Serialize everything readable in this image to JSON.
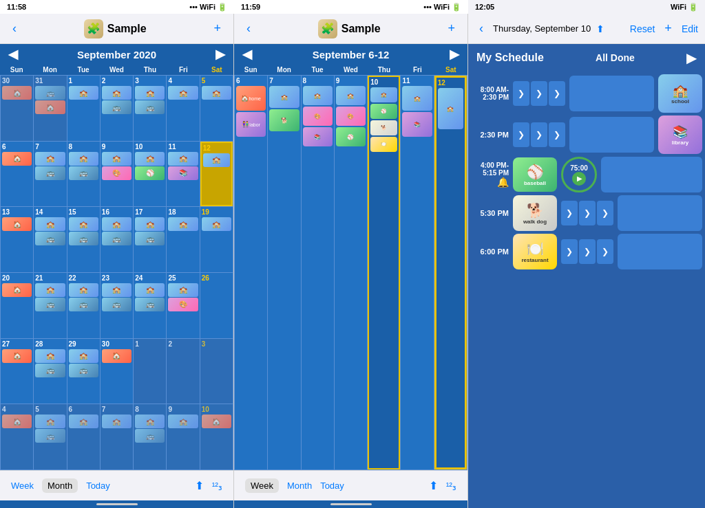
{
  "panels": {
    "panel1": {
      "status_time": "11:58",
      "nav_title": "Sample",
      "cal_title": "September 2020",
      "view_mode": "Month",
      "toolbar": {
        "week_label": "Week",
        "month_label": "Month",
        "today_label": "Today"
      }
    },
    "panel2": {
      "status_time": "11:59",
      "nav_title": "Sample",
      "cal_title": "September 6-12",
      "toolbar": {
        "week_label": "Week",
        "month_label": "Month",
        "today_label": "Today"
      }
    },
    "panel3": {
      "status_time": "12:05",
      "nav_title": "Thursday, September 10",
      "reset_label": "Reset",
      "edit_label": "Edit",
      "schedule_title": "My Schedule",
      "all_done_label": "All Done",
      "times": [
        {
          "time": "8:00 AM-\n2:30 PM",
          "event": "school",
          "type": "school",
          "done": true
        },
        {
          "time": "2:30 PM",
          "event": "library",
          "type": "library",
          "done": true
        },
        {
          "time": "4:00 PM-\n5:15 PM",
          "event": "baseball",
          "type": "baseball",
          "timer": "75:00",
          "active": true
        },
        {
          "time": "5:30 PM",
          "event": "walk dog",
          "type": "dog",
          "done": false
        },
        {
          "time": "6:00 PM",
          "event": "restaurant",
          "type": "restaurant",
          "done": false
        }
      ]
    }
  },
  "days": [
    "Sun",
    "Mon",
    "Tue",
    "Wed",
    "Thu",
    "Fri",
    "Sat"
  ],
  "month_weeks": [
    [
      {
        "num": "30",
        "other": true,
        "events": [
          "home"
        ]
      },
      {
        "num": "31",
        "other": true,
        "events": [
          "bus",
          "home"
        ]
      },
      {
        "num": "1",
        "events": [
          "school"
        ]
      },
      {
        "num": "2",
        "events": [
          "school",
          "bus"
        ]
      },
      {
        "num": "3",
        "events": [
          "school",
          "bus"
        ]
      },
      {
        "num": "4",
        "events": [
          "school"
        ]
      },
      {
        "num": "5",
        "events": [
          "school"
        ]
      }
    ],
    [
      {
        "num": "6",
        "events": [
          "home"
        ]
      },
      {
        "num": "7",
        "events": [
          "school",
          "bus"
        ]
      },
      {
        "num": "8",
        "events": [
          "school",
          "bus"
        ]
      },
      {
        "num": "9",
        "events": [
          "school",
          "art"
        ]
      },
      {
        "num": "10",
        "events": [
          "school",
          "baseball"
        ]
      },
      {
        "num": "11",
        "events": [
          "school",
          "library"
        ]
      },
      {
        "num": "12",
        "events": [
          "school"
        ],
        "highlight": true
      }
    ],
    [
      {
        "num": "13",
        "events": [
          "home"
        ]
      },
      {
        "num": "14",
        "events": [
          "school",
          "bus"
        ]
      },
      {
        "num": "15",
        "events": [
          "school",
          "bus"
        ]
      },
      {
        "num": "16",
        "events": [
          "school",
          "bus"
        ]
      },
      {
        "num": "17",
        "events": [
          "school",
          "bus"
        ]
      },
      {
        "num": "18",
        "events": [
          "school"
        ]
      },
      {
        "num": "19",
        "events": [
          "school"
        ]
      }
    ],
    [
      {
        "num": "20",
        "events": [
          "home"
        ]
      },
      {
        "num": "21",
        "events": [
          "school",
          "bus"
        ]
      },
      {
        "num": "22",
        "events": [
          "school",
          "bus"
        ]
      },
      {
        "num": "23",
        "events": [
          "school",
          "bus"
        ]
      },
      {
        "num": "24",
        "events": [
          "school",
          "bus"
        ]
      },
      {
        "num": "25",
        "events": [
          "school",
          "art"
        ]
      },
      {
        "num": "26",
        "events": []
      }
    ],
    [
      {
        "num": "27",
        "events": [
          "home"
        ]
      },
      {
        "num": "28",
        "events": [
          "school",
          "bus"
        ]
      },
      {
        "num": "29",
        "events": [
          "school",
          "bus"
        ]
      },
      {
        "num": "30",
        "events": [
          "home"
        ]
      },
      {
        "num": "1",
        "other": true,
        "events": []
      },
      {
        "num": "2",
        "other": true,
        "events": []
      },
      {
        "num": "3",
        "other": true,
        "events": []
      }
    ],
    [
      {
        "num": "4",
        "other": true,
        "events": [
          "home"
        ]
      },
      {
        "num": "5",
        "other": true,
        "events": [
          "school",
          "bus"
        ]
      },
      {
        "num": "6",
        "other": true,
        "events": [
          "school"
        ]
      },
      {
        "num": "7",
        "other": true,
        "events": [
          "school"
        ]
      },
      {
        "num": "8",
        "other": true,
        "events": [
          "school",
          "bus"
        ]
      },
      {
        "num": "9",
        "other": true,
        "events": [
          "school"
        ]
      },
      {
        "num": "10",
        "other": true,
        "events": [
          "home"
        ]
      }
    ]
  ],
  "week_days": [
    "Sun",
    "Mon",
    "Tue",
    "Wed",
    "Thu",
    "Fri",
    "Sat"
  ],
  "week_data": {
    "6": [
      "home",
      "labor"
    ],
    "7": [
      "school",
      "walk"
    ],
    "8": [
      "school",
      "art",
      "library"
    ],
    "9": [
      "school",
      "art",
      "baseball"
    ],
    "10": [
      "school",
      "baseball",
      "walk",
      "restaurant"
    ],
    "11": [
      "school",
      "library"
    ],
    "12": [
      "school"
    ]
  },
  "icons": {
    "back": "‹",
    "forward": "›",
    "plus": "+",
    "share": "⬆",
    "numbers": "¹²₃",
    "arrow_right": "›",
    "chevron_right": "❯",
    "play": "▶",
    "bell": "🔔"
  }
}
